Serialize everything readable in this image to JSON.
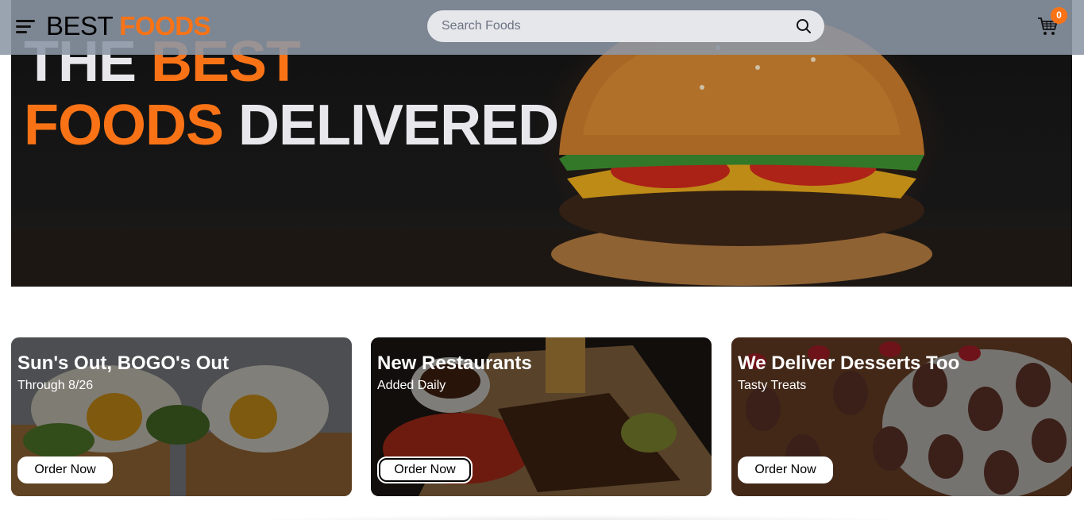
{
  "navbar": {
    "logo_part1": "BEST",
    "logo_part2": "FOODS",
    "search_placeholder": "Search Foods",
    "cart_count": "0"
  },
  "hero": {
    "line1_white": "THE",
    "line1_orange": "BEST",
    "line2_orange": "FOODS",
    "line2_white": "DELIVERED"
  },
  "cards": [
    {
      "title": "Sun's Out, BOGO's Out",
      "subtitle": "Through 8/26",
      "button": "Order Now"
    },
    {
      "title": "New Restaurants",
      "subtitle": "Added Daily",
      "button": "Order Now"
    },
    {
      "title": "We Deliver Desserts Too",
      "subtitle": "Tasty Treats",
      "button": "Order Now"
    }
  ],
  "colors": {
    "accent": "#f97316",
    "navbar_bg": "#8c96a5",
    "search_bg": "#e5e7eb"
  },
  "icons": [
    "menu-icon",
    "search-icon",
    "cart-icon"
  ]
}
